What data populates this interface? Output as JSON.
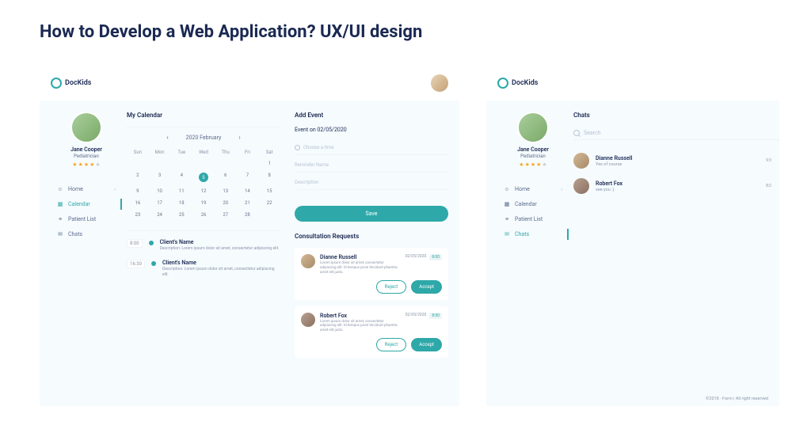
{
  "page_title": "How to Develop a Web Application? UX/UI design",
  "brand": "DocKids",
  "user": {
    "name": "Jane Cooper",
    "role": "Pediatrician",
    "rating_filled": 4,
    "rating_empty": 1
  },
  "nav": {
    "home": "Home",
    "calendar": "Calendar",
    "patient_list": "Patient List",
    "chats": "Chats"
  },
  "frame1": {
    "cal_title": "My Calendar",
    "month_label": "2020  February",
    "dow": [
      "Sun",
      "Mon",
      "Tue",
      "Wed",
      "Thu",
      "Fri",
      "Sat"
    ],
    "weeks": [
      [
        "",
        "",
        "",
        "",
        "",
        "",
        "1"
      ],
      [
        "2",
        "3",
        "4",
        "5",
        "6",
        "7",
        "8"
      ],
      [
        "9",
        "10",
        "11",
        "12",
        "13",
        "14",
        "15"
      ],
      [
        "16",
        "17",
        "18",
        "19",
        "20",
        "21",
        "22"
      ],
      [
        "23",
        "24",
        "25",
        "26",
        "27",
        "28",
        ""
      ]
    ],
    "today": "5",
    "events": [
      {
        "time": "8:00",
        "name": "Client's Name",
        "desc": "Description: Lorem ipsum dolor sit amet, consectetur adipiscing elit."
      },
      {
        "time": "16:30",
        "name": "Client's Name",
        "desc": "Description: Lorem ipsum dolor sit amet, consectetur adipiscing elit."
      }
    ],
    "add_event": {
      "title": "Add Event",
      "subtitle": "Event on 02/05/2020",
      "placeholder_time": "Choose a time",
      "placeholder_reminder": "Reminder Name",
      "placeholder_desc": "Description",
      "save": "Save"
    },
    "consult_title": "Consultation Requests",
    "requests": [
      {
        "name": "Dianne Russell",
        "date": "02/05/2020",
        "time": "8:00",
        "desc": "Lorem ipsum dolor sit amet, consectetur adipiscing elit. Id tempus proin tincidunt pharetra amet elit justo.",
        "reject": "Reject",
        "accept": "Accept"
      },
      {
        "name": "Robert Fox",
        "date": "02/05/2020",
        "time": "8:00",
        "desc": "Lorem ipsum dolor sit amet, consectetur adipiscing elit. Id tempus proin tincidunt pharetra amet elit justo.",
        "reject": "Reject",
        "accept": "Accept"
      }
    ]
  },
  "frame2": {
    "chats_title": "Chats",
    "search_placeholder": "Search",
    "chats": [
      {
        "name": "Dianne Russell",
        "msg": "Yes of course",
        "time": "9:3"
      },
      {
        "name": "Robert Fox",
        "msg": "see you :)",
        "time": "8:2"
      }
    ],
    "footer": "©2018 - Form  |  All right reserved"
  }
}
